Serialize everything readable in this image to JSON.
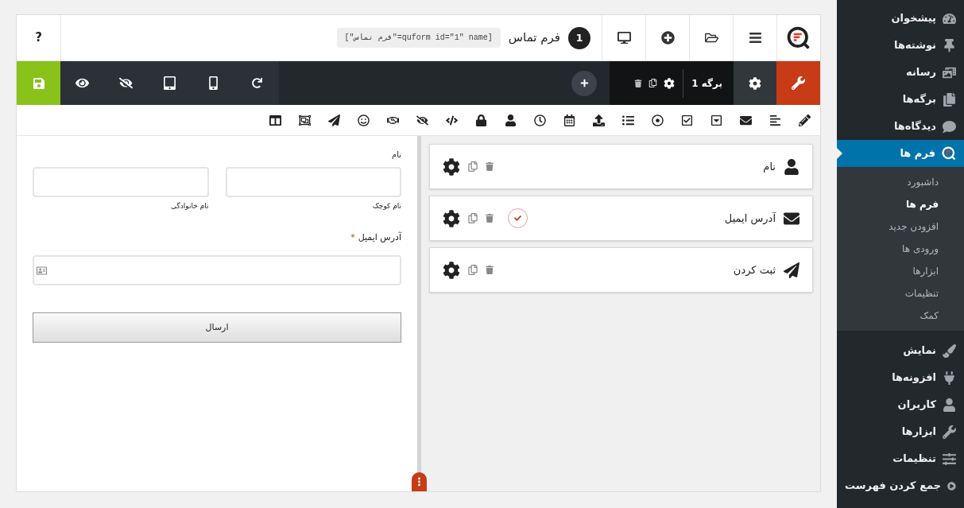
{
  "header": {
    "help": "?",
    "form_number": "1",
    "form_name": "فرم تماس",
    "shortcode": "[quform id=\"1\" name=\"فرم تماس\"]"
  },
  "page_tab": {
    "label": "برگه 1",
    "selected": true
  },
  "elements": [
    {
      "kind": "user",
      "label": "نام",
      "required": false
    },
    {
      "kind": "email",
      "label": "آدرس ایمیل",
      "required": true
    },
    {
      "kind": "submit",
      "label": "ثبت کردن",
      "required": false
    }
  ],
  "preview": {
    "name_label": "نام",
    "first_sublabel": "نام کوچک",
    "last_sublabel": "نام خانوادگی",
    "email_label": "آدرس ایمیل",
    "required_mark": "*",
    "submit": "ارسال"
  },
  "sidebar": {
    "items": [
      {
        "kind": "dashboard",
        "label": "پیشخوان",
        "selected": false
      },
      {
        "kind": "pin",
        "label": "نوشته‌ها",
        "selected": false
      },
      {
        "kind": "media",
        "label": "رسانه",
        "selected": false
      },
      {
        "kind": "pages",
        "label": "برگه‌ها",
        "selected": false
      },
      {
        "kind": "comments",
        "label": "دیدگاه‌ها",
        "selected": false
      },
      {
        "kind": "forms",
        "label": "فرم ها",
        "selected": true,
        "children": [
          {
            "label": "داشبورد",
            "selected": false
          },
          {
            "label": "فرم ها",
            "selected": true
          },
          {
            "label": "افزودن جدید",
            "selected": false
          },
          {
            "label": "ورودی ها",
            "selected": false
          },
          {
            "label": "ابزارها",
            "selected": false
          },
          {
            "label": "تنظیمات",
            "selected": false
          },
          {
            "label": "کمک",
            "selected": false
          }
        ]
      },
      {
        "kind": "appearance",
        "label": "نمایش",
        "selected": false
      },
      {
        "kind": "plugins",
        "label": "افزونه‌ها",
        "selected": false
      },
      {
        "kind": "users",
        "label": "کاربران",
        "selected": false
      },
      {
        "kind": "tools",
        "label": "ابزارها",
        "selected": false
      },
      {
        "kind": "settings",
        "label": "تنظیمات",
        "selected": false
      },
      {
        "kind": "collapse",
        "label": "جمع کردن فهرست",
        "selected": false
      }
    ]
  }
}
